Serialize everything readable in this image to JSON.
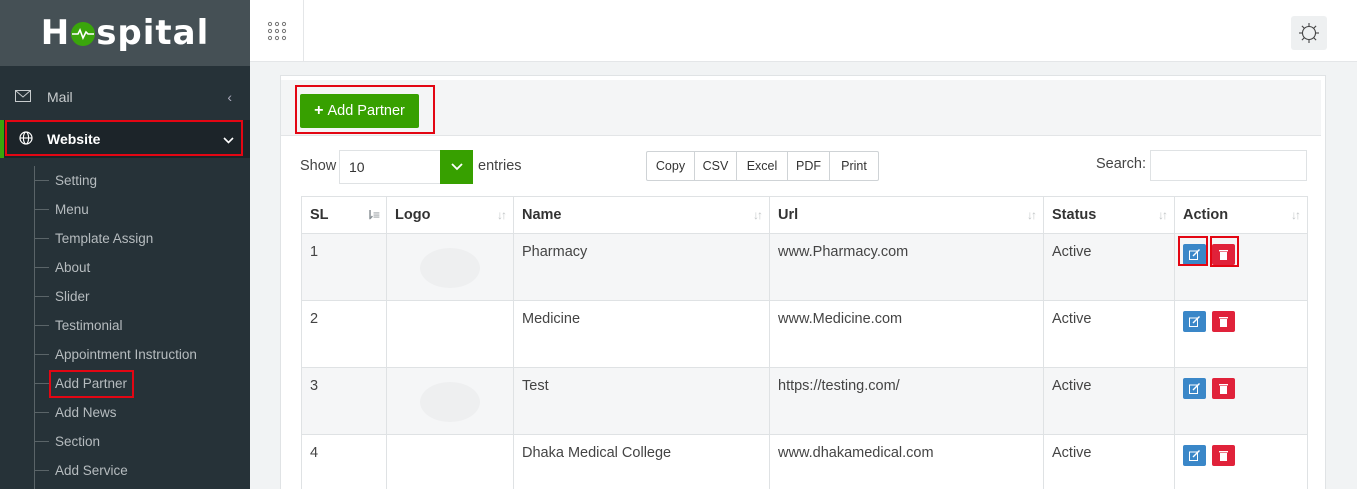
{
  "sidebar": {
    "logo_text_pre": "H",
    "logo_text_post": "spital",
    "nav": [
      {
        "label": "Mail",
        "icon": "mail-icon"
      },
      {
        "label": "Website",
        "icon": "globe-icon"
      }
    ],
    "submenu": [
      "Setting",
      "Menu",
      "Template Assign",
      "About",
      "Slider",
      "Testimonial",
      "Appointment Instruction",
      "Add Partner",
      "Add News",
      "Section",
      "Add Service"
    ]
  },
  "card": {
    "add_button": "Add Partner",
    "show_label": "Show",
    "length_value": "10",
    "entries_label": "entries",
    "export_buttons": [
      "Copy",
      "CSV",
      "Excel",
      "PDF",
      "Print"
    ],
    "search_label": "Search:"
  },
  "table": {
    "headers": [
      "SL",
      "Logo",
      "Name",
      "Url",
      "Status",
      "Action"
    ],
    "rows": [
      {
        "sl": "1",
        "name": "Pharmacy",
        "url": "www.Pharmacy.com",
        "status": "Active"
      },
      {
        "sl": "2",
        "name": "Medicine",
        "url": "www.Medicine.com",
        "status": "Active"
      },
      {
        "sl": "3",
        "name": "Test",
        "url": "https://testing.com/",
        "status": "Active"
      },
      {
        "sl": "4",
        "name": "Dhaka Medical College",
        "url": "www.dhakamedical.com",
        "status": "Active"
      }
    ]
  },
  "colors": {
    "accent_green": "#37a000",
    "sidebar_bg": "#263238",
    "edit_blue": "#3a87c8",
    "delete_red": "#e0223a",
    "highlight_red": "#e30613"
  }
}
